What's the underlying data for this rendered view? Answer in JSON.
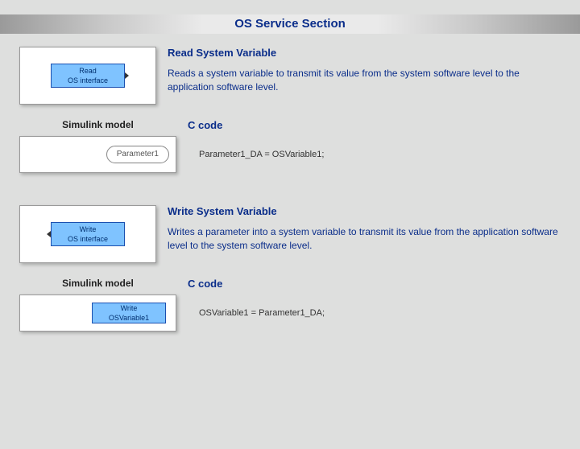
{
  "title": "OS Service Section",
  "read": {
    "heading": "Read System Variable",
    "description": "Reads a system variable to transmit its value from the system software level to the application software level.",
    "block_line1": "Read",
    "block_line2": "OS interface",
    "simulink_label": "Simulink model",
    "code_label": "C code",
    "param_block": "Parameter1",
    "code": "Parameter1_DA = OSVariable1;"
  },
  "write": {
    "heading": "Write System Variable",
    "description": "Writes a parameter into a system variable to transmit its value from the application software level to the system software level.",
    "block_line1": "Write",
    "block_line2": "OS interface",
    "simulink_label": "Simulink model",
    "code_label": "C code",
    "write_block_line1": "Write",
    "write_block_line2": "OSVariable1",
    "code": "OSVariable1 = Parameter1_DA;"
  }
}
